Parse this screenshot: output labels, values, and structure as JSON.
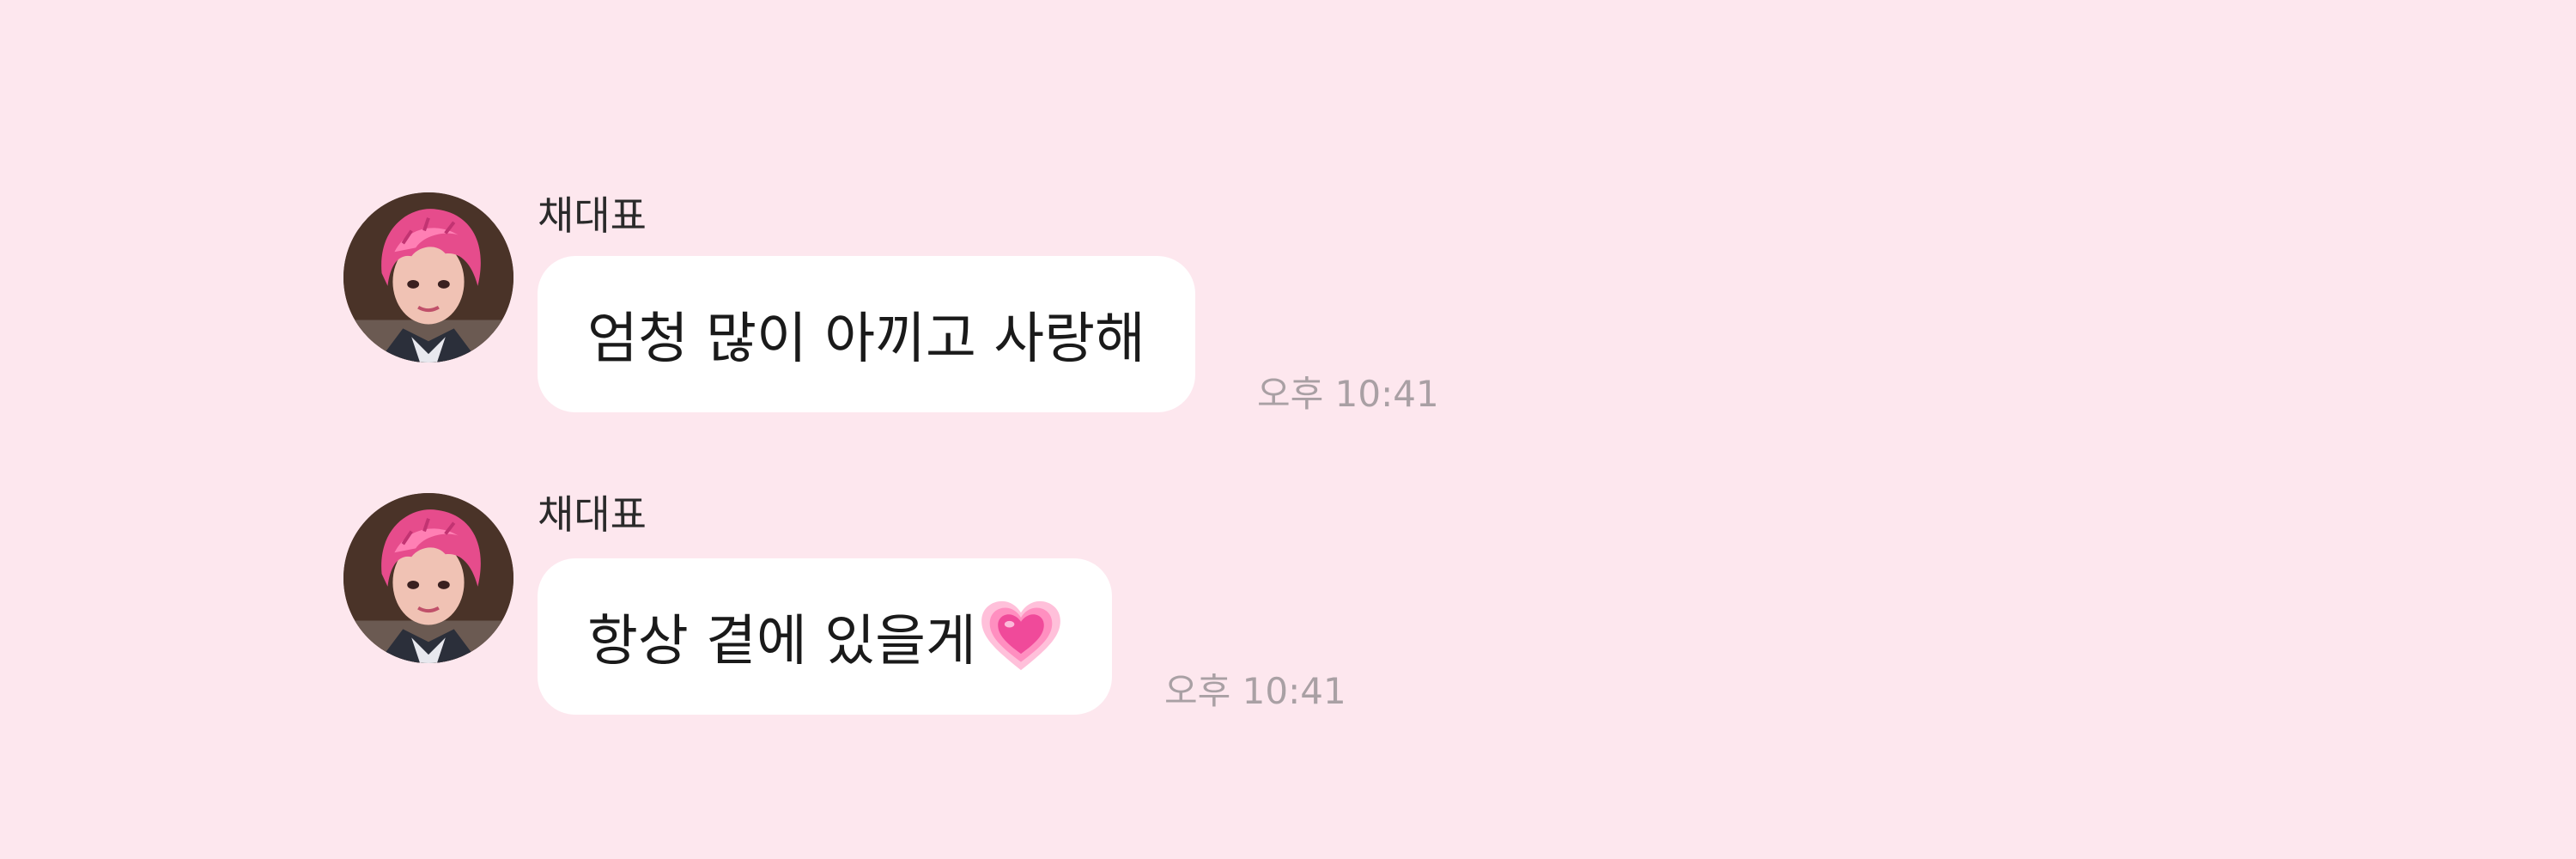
{
  "messages": [
    {
      "sender": "채대표",
      "text": "엄청 많이 아끼고 사랑해",
      "time": "오후 10:41",
      "avatar": "profile-avatar-pink-hair"
    },
    {
      "sender": "채대표",
      "text": "항상 곁에 있을게",
      "emoji": "growing-heart-icon",
      "time": "오후 10:41",
      "avatar": "profile-avatar-pink-hair"
    }
  ],
  "colors": {
    "background": "#fde7ee",
    "bubble": "#ffffff",
    "sender_text": "#2a2a2a",
    "message_text": "#1a1a1a",
    "timestamp": "#a9a0a4",
    "heart": "#f04a9a"
  }
}
